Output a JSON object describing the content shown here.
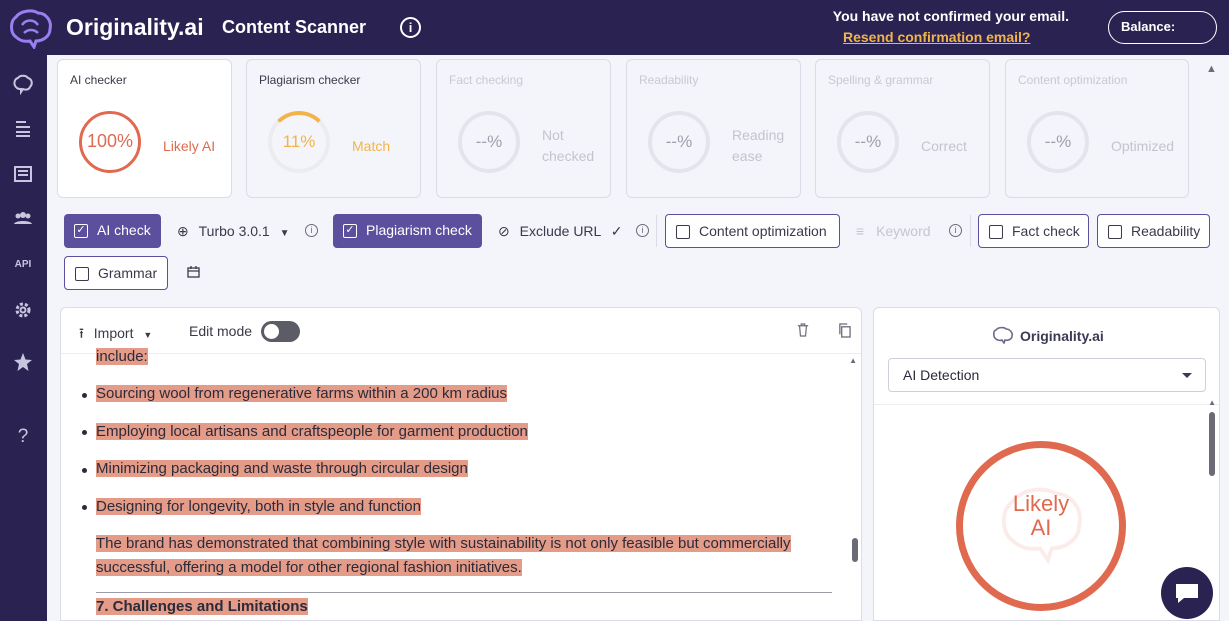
{
  "header": {
    "brand": "Originality.ai",
    "app_title": "Content Scanner",
    "email_notice": "You have not confirmed your email.",
    "resend_link": "Resend confirmation email?",
    "balance_label": "Balance:"
  },
  "sidebar": {
    "items": [
      {
        "icon": "brain-icon"
      },
      {
        "icon": "scan-icon"
      },
      {
        "icon": "library-icon"
      },
      {
        "icon": "team-icon"
      },
      {
        "label": "API"
      },
      {
        "icon": "gear-icon"
      },
      {
        "icon": "star-icon"
      },
      {
        "label": "?"
      }
    ]
  },
  "cards": [
    {
      "title": "AI checker",
      "score": "100%",
      "label": "Likely AI"
    },
    {
      "title": "Plagiarism checker",
      "score": "11%",
      "label": "Match",
      "progress": 0.11
    },
    {
      "title": "Fact checking",
      "score": "--%",
      "label_lines": [
        "Not",
        "checked"
      ]
    },
    {
      "title": "Readability",
      "score": "--%",
      "label_lines": [
        "Reading",
        "ease"
      ]
    },
    {
      "title": "Spelling & grammar",
      "score": "--%",
      "label": "Correct"
    },
    {
      "title": "Content optimization",
      "score": "--%",
      "label": "Optimized"
    }
  ],
  "toolbar": {
    "ai_check": "AI check",
    "model": "Turbo 3.0.1",
    "plagiarism_check": "Plagiarism check",
    "exclude_url": "Exclude URL",
    "content_optimization": "Content optimization",
    "keyword": "Keyword",
    "fact_check": "Fact check",
    "readability": "Readability",
    "grammar": "Grammar"
  },
  "editor": {
    "import_label": "Import",
    "edit_mode_label": "Edit mode",
    "top_partial": "include:",
    "bullets": [
      "Sourcing wool from regenerative farms within a 200 km radius",
      "Employing local artisans and craftspeople for garment production",
      "Minimizing packaging and waste through circular design",
      "Designing for longevity, both in style and function"
    ],
    "paragraph_lines": [
      "The brand has demonstrated that combining style with sustainability is not only feasible but commercially",
      "successful, offering a model for other regional fashion initiatives."
    ],
    "heading": "7.  Challenges and Limitations"
  },
  "panel": {
    "brand": "Originality.ai",
    "select_value": "AI Detection",
    "result_lines": [
      "Likely",
      "AI"
    ]
  },
  "colors": {
    "nav_bg": "#2a2352",
    "accent": "#5b4f9e",
    "ai_red": "#e06a4f",
    "match_orange": "#f2b44a",
    "highlight": "#e49b88"
  }
}
